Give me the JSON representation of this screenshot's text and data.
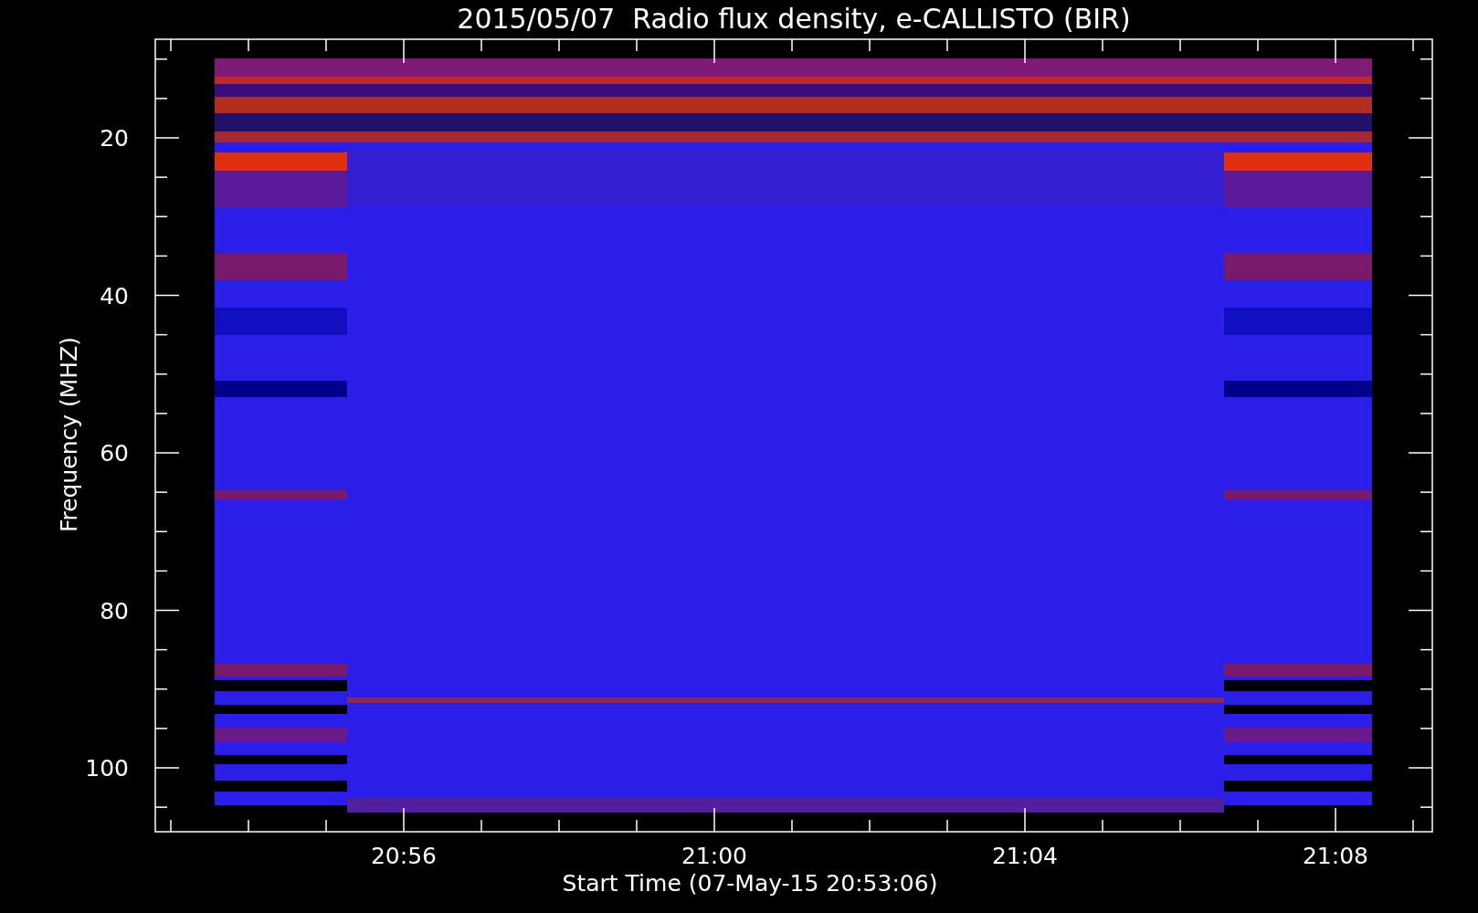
{
  "title": "2015/05/07  Radio flux density, e-CALLISTO (BIR)",
  "ylabel": "Frequency (MHZ)",
  "xlabel": "Start Time (07-May-15 20:53:06)",
  "yticks": [
    "20",
    "40",
    "60",
    "80",
    "100"
  ],
  "xticks": [
    "20:56",
    "21:00",
    "21:04",
    "21:08"
  ]
}
